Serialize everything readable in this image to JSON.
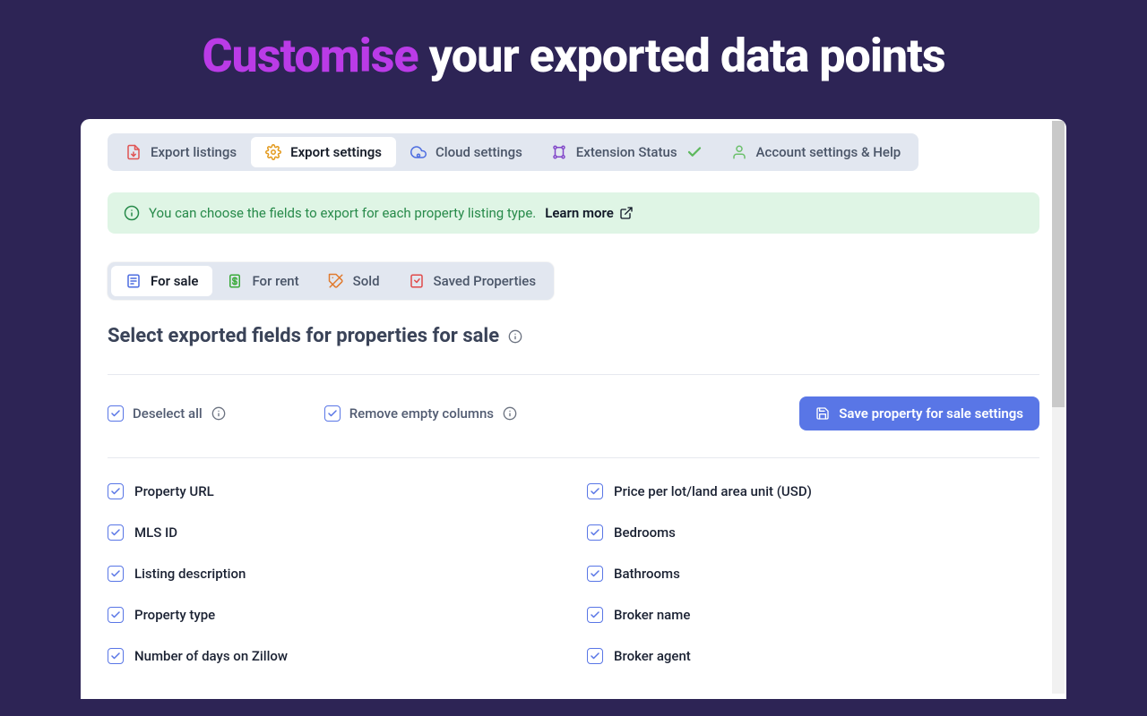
{
  "hero": {
    "accent": "Customise",
    "rest": " your exported data points"
  },
  "tabs_top": {
    "export_listings": "Export listings",
    "export_settings": "Export settings",
    "cloud_settings": "Cloud settings",
    "extension_status": "Extension Status",
    "account_settings_help": "Account settings & Help"
  },
  "banner": {
    "text": "You can choose the fields to export for each property listing type.",
    "learn_more": "Learn more"
  },
  "tabs_type": {
    "for_sale": "For sale",
    "for_rent": "For rent",
    "sold": "Sold",
    "saved": "Saved Properties"
  },
  "section": {
    "title": "Select exported fields for properties for sale"
  },
  "controls": {
    "deselect_all": "Deselect all",
    "remove_empty": "Remove empty columns",
    "save_button": "Save property for sale settings"
  },
  "fields_left": [
    "Property URL",
    "MLS ID",
    "Listing description",
    "Property type",
    "Number of days on Zillow"
  ],
  "fields_right": [
    "Price per lot/land area unit (USD)",
    "Bedrooms",
    "Bathrooms",
    "Broker name",
    "Broker agent"
  ]
}
